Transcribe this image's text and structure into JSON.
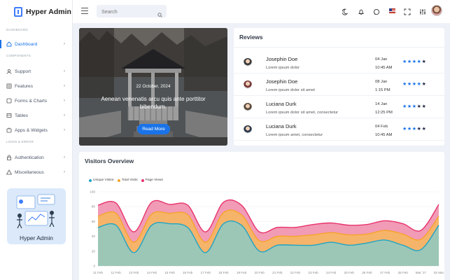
{
  "app": {
    "name": "Hyper Admin"
  },
  "sidebar": {
    "sections": [
      "DASHBOARD",
      "COMPONENTS",
      "LOGIN & ERROR"
    ],
    "items": [
      {
        "label": "Dashboard",
        "icon": "home-icon",
        "active": true
      },
      {
        "label": "Support",
        "icon": "user-icon"
      },
      {
        "label": "Features",
        "icon": "grid-icon"
      },
      {
        "label": "Forms & Charts",
        "icon": "chart-icon"
      },
      {
        "label": "Tables",
        "icon": "table-icon"
      },
      {
        "label": "Apps & Widgets",
        "icon": "apps-icon"
      },
      {
        "label": "Authentication",
        "icon": "lock-icon"
      },
      {
        "label": "Miscellaneous",
        "icon": "warning-icon"
      }
    ],
    "promo_title": "Hyper Admin"
  },
  "topbar": {
    "search_placeholder": "Search",
    "icons": [
      "moon-icon",
      "bell-icon",
      "chat-icon",
      "flag-us-icon",
      "fullscreen-icon",
      "settings-sliders-icon",
      "avatar"
    ]
  },
  "hero": {
    "date": "22 October, 2024",
    "text": "Aenean venenatis arcu quis ante porttitor bibendum.",
    "button": "Read More"
  },
  "reviews": {
    "title": "Reviews",
    "rows": [
      {
        "name": "Josephin Doe",
        "text": "Lorem ipsum dolor",
        "date": "04 Jan",
        "time": "10:45 AM",
        "stars": 4
      },
      {
        "name": "Josephin Doe",
        "text": "Lorem ipsum dolor sit amet",
        "date": "08 Jan",
        "time": "1:15 PM",
        "stars": 4
      },
      {
        "name": "Luciana Durk",
        "text": "Lorem ipsum dolor sit amet, consectetur",
        "date": "14 Jan",
        "time": "12:25 PM",
        "stars": 3
      },
      {
        "name": "Luciana Durk",
        "text": "Lorem ipsum amet, consectetur",
        "date": "04 Feb",
        "time": "10:45 AM",
        "stars": 3
      }
    ]
  },
  "visitors": {
    "title": "Visitors Overview"
  },
  "colors": {
    "accent": "#1a73e8",
    "unique": "#20a4c4",
    "total": "#f7a42a",
    "pageviews": "#e8336b"
  },
  "chart_data": {
    "type": "area",
    "x": [
      "11 Feb",
      "12 Feb",
      "13 Feb",
      "14 Feb",
      "15 Feb",
      "16 Feb",
      "17 Feb",
      "18 Feb",
      "19 Feb",
      "20 Feb",
      "21 Feb",
      "22 Feb",
      "23 Feb",
      "24 Feb",
      "25 Feb",
      "26 Feb",
      "27 Feb",
      "28 Feb",
      "Mar '17",
      "02 Mar"
    ],
    "ylim": [
      0,
      100
    ],
    "yticks": [
      0,
      20,
      40,
      60,
      80,
      100
    ],
    "stacked": true,
    "legend_position": "top-left",
    "series": [
      {
        "name": "Unique Visitor",
        "values": [
          52,
          55,
          18,
          55,
          57,
          52,
          18,
          57,
          55,
          20,
          28,
          28,
          28,
          32,
          28,
          31,
          35,
          28,
          22,
          55
        ]
      },
      {
        "name": "Total Visits",
        "values": [
          15,
          16,
          14,
          15,
          14,
          17,
          14,
          15,
          14,
          14,
          12,
          12,
          14,
          13,
          14,
          12,
          13,
          15,
          14,
          12
        ]
      },
      {
        "name": "Page Views",
        "values": [
          15,
          14,
          14,
          16,
          12,
          13,
          14,
          14,
          13,
          12,
          12,
          12,
          14,
          13,
          13,
          13,
          13,
          14,
          12,
          16
        ]
      }
    ]
  }
}
